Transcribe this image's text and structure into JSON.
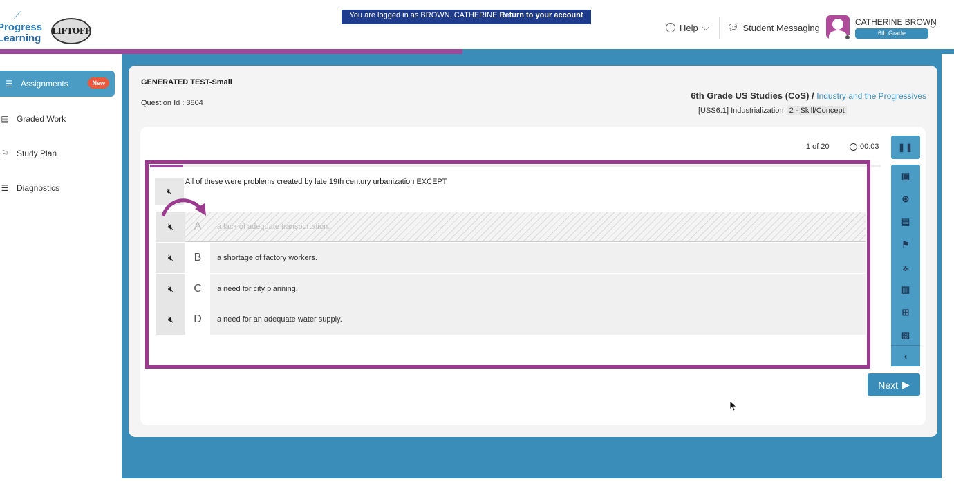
{
  "header": {
    "logo_line1": "Progress",
    "logo_line2": "Learning",
    "liftoff_label": "LIFTOFF",
    "banner_prefix": "You are logged in as BROWN, CATHERINE",
    "banner_link": "Return to your account",
    "help_label": "Help",
    "messaging_label": "Student Messaging",
    "user_name": "CATHERINE BROWN",
    "user_grade": "6th Grade",
    "progress_pct": 48.5
  },
  "sidebar": {
    "items": [
      {
        "label": "Assignments",
        "badge": "New"
      },
      {
        "label": "Graded Work"
      },
      {
        "label": "Study Plan"
      },
      {
        "label": "Diagnostics"
      }
    ]
  },
  "test": {
    "title": "GENERATED TEST-Small",
    "question_id": "Question Id : 3804",
    "course": "6th Grade US Studies (CoS) /",
    "topic": "Industry and the Progressives",
    "standard": "[USS6.1] Industrialization",
    "skill": "2 - Skill/Concept",
    "counter": "1 of 20",
    "timer": "00:03"
  },
  "question": {
    "text": "All of these were problems created by late 19th century urbanization EXCEPT",
    "choices": [
      {
        "letter": "A",
        "text": "a lack of adequate transportation.",
        "struck": true
      },
      {
        "letter": "B",
        "text": "a shortage of factory workers.",
        "struck": false
      },
      {
        "letter": "C",
        "text": "a need for city planning.",
        "struck": false
      },
      {
        "letter": "D",
        "text": "a need for an adequate water supply.",
        "struck": false
      }
    ]
  },
  "nav": {
    "next_label": "Next"
  },
  "colors": {
    "brand_blue": "#3a8db9",
    "accent_purple": "#9b3a8e",
    "badge_red": "#e85a3b",
    "banner_navy": "#1f3c8c"
  }
}
